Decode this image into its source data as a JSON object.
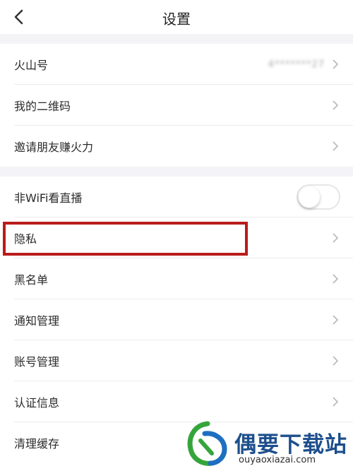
{
  "header": {
    "title": "设置"
  },
  "group1": {
    "items": [
      {
        "label": "火山号",
        "value": "4*******27"
      },
      {
        "label": "我的二维码"
      },
      {
        "label": "邀请朋友赚火力"
      }
    ]
  },
  "group2": {
    "items": [
      {
        "label": "非WiFi看直播",
        "toggle_on": false
      },
      {
        "label": "隐私"
      },
      {
        "label": "黑名单"
      },
      {
        "label": "通知管理"
      },
      {
        "label": "账号管理"
      },
      {
        "label": "认证信息"
      },
      {
        "label": "清理缓存"
      }
    ]
  },
  "watermark": {
    "title": "偶要下载站",
    "url": "ouyaoxiazai.com"
  },
  "colors": {
    "highlight": "#b91c1c",
    "watermark_blue": "#1d4f8c",
    "watermark_green": "#35a53b"
  },
  "icons": [
    "back-arrow-icon",
    "chevron-right-icon",
    "watermark-logo-icon"
  ]
}
